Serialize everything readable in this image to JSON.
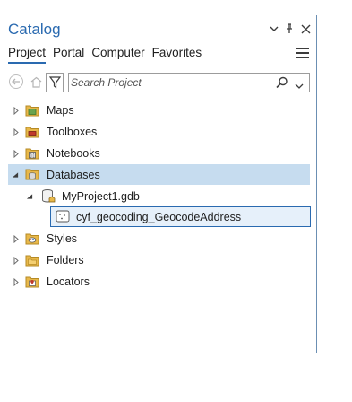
{
  "pane": {
    "title": "Catalog",
    "window_buttons": [
      "chevron-down",
      "pin",
      "close"
    ]
  },
  "tabs": [
    {
      "label": "Project",
      "active": true
    },
    {
      "label": "Portal",
      "active": false
    },
    {
      "label": "Computer",
      "active": false
    },
    {
      "label": "Favorites",
      "active": false
    }
  ],
  "search": {
    "placeholder": "Search Project"
  },
  "tree": {
    "maps": "Maps",
    "toolboxes": "Toolboxes",
    "notebooks": "Notebooks",
    "databases": "Databases",
    "gdb": "MyProject1.gdb",
    "feature_class": "cyf_geocoding_GeocodeAddress",
    "styles": "Styles",
    "folders": "Folders",
    "locators": "Locators"
  },
  "colors": {
    "accent": "#2a6ab0",
    "selected_row": "#c6dcef",
    "folder_yellow": "#e8b84a"
  }
}
